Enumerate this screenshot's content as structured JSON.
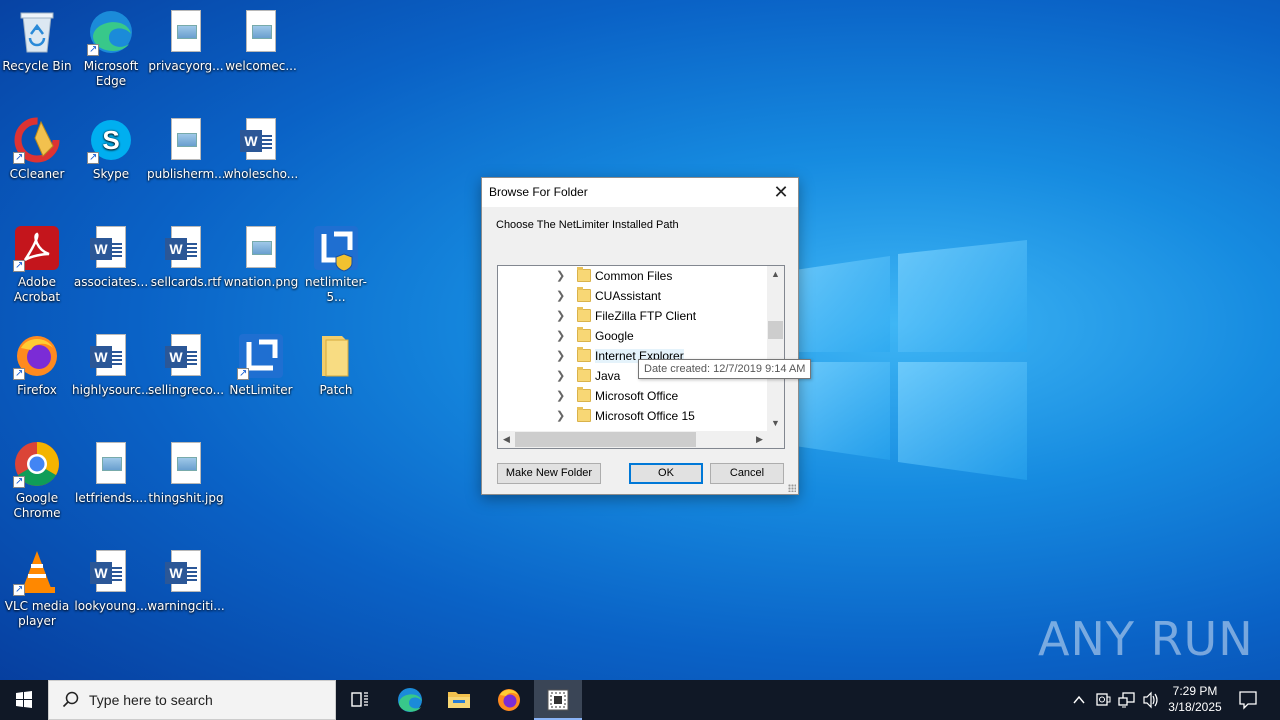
{
  "desktop": {
    "icons": [
      {
        "label": "Recycle Bin",
        "icon": "recycle-bin-icon"
      },
      {
        "label": "Microsoft Edge",
        "icon": "edge-icon"
      },
      {
        "label": "privacyorg...",
        "icon": "image-file-icon"
      },
      {
        "label": "welcomec...",
        "icon": "image-file-icon"
      },
      {
        "label": "CCleaner",
        "icon": "ccleaner-icon"
      },
      {
        "label": "Skype",
        "icon": "skype-icon"
      },
      {
        "label": "publisherm...",
        "icon": "image-file-icon"
      },
      {
        "label": "wholescho...",
        "icon": "word-document-icon"
      },
      {
        "label": "Adobe Acrobat",
        "icon": "acrobat-icon"
      },
      {
        "label": "associates...",
        "icon": "word-document-icon"
      },
      {
        "label": "sellcards.rtf",
        "icon": "word-document-icon"
      },
      {
        "label": "wnation.png",
        "icon": "image-file-icon"
      },
      {
        "label": "netlimiter-5...",
        "icon": "netlimiter-installer-icon"
      },
      {
        "label": "Firefox",
        "icon": "firefox-icon"
      },
      {
        "label": "highlysourc...",
        "icon": "word-document-icon"
      },
      {
        "label": "sellingreco...",
        "icon": "word-document-icon"
      },
      {
        "label": "NetLimiter",
        "icon": "netlimiter-icon"
      },
      {
        "label": "Patch",
        "icon": "folder-icon"
      },
      {
        "label": "Google Chrome",
        "icon": "chrome-icon"
      },
      {
        "label": "letfriends....",
        "icon": "image-file-icon"
      },
      {
        "label": "thingshit.jpg",
        "icon": "image-file-icon"
      },
      {
        "label": "VLC media player",
        "icon": "vlc-icon"
      },
      {
        "label": "lookyoung...",
        "icon": "word-document-icon"
      },
      {
        "label": "warningciti...",
        "icon": "word-document-icon"
      }
    ]
  },
  "dialog": {
    "title": "Browse For Folder",
    "close_glyph": "✕",
    "prompt": "Choose The NetLimiter Installed Path",
    "tree_items": [
      "Common Files",
      "CUAssistant",
      "FileZilla FTP Client",
      "Google",
      "Internet Explorer",
      "Java",
      "Microsoft Office",
      "Microsoft Office 15"
    ],
    "make_new_folder_label": "Make New Folder",
    "ok_label": "OK",
    "cancel_label": "Cancel",
    "tooltip": "Date created: 12/7/2019 9:14 AM"
  },
  "taskbar": {
    "search_placeholder": "Type here to search",
    "time": "7:29 PM",
    "date": "3/18/2025",
    "pinned": [
      "task-view-icon",
      "edge-icon",
      "file-explorer-icon",
      "firefox-icon",
      "netlimiter-setup-icon"
    ]
  },
  "watermark": "ANY RUN",
  "colors": {
    "accent": "#0078d7",
    "desktop": "#0a62c6",
    "taskbar": "#101826"
  }
}
